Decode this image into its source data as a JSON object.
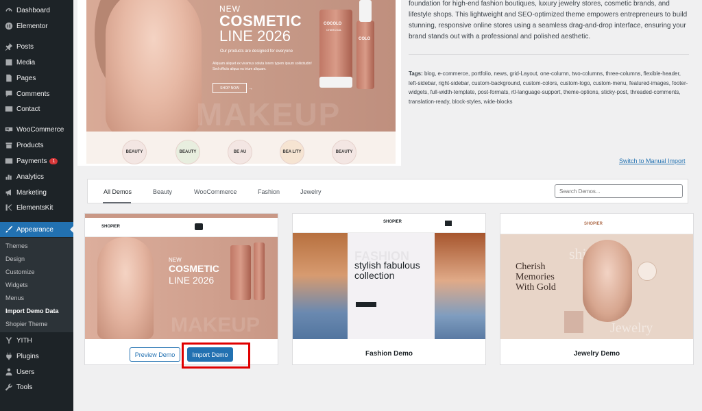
{
  "sidebar": {
    "items": [
      {
        "label": "Dashboard",
        "icon": "dashboard-icon"
      },
      {
        "label": "Elementor",
        "icon": "elementor-icon"
      },
      {
        "label": "Posts",
        "icon": "pin-icon"
      },
      {
        "label": "Media",
        "icon": "media-icon"
      },
      {
        "label": "Pages",
        "icon": "pages-icon"
      },
      {
        "label": "Comments",
        "icon": "comment-icon"
      },
      {
        "label": "Contact",
        "icon": "mail-icon"
      },
      {
        "label": "WooCommerce",
        "icon": "woocommerce-icon"
      },
      {
        "label": "Products",
        "icon": "products-icon"
      },
      {
        "label": "Payments",
        "icon": "payments-icon",
        "badge": "1"
      },
      {
        "label": "Analytics",
        "icon": "analytics-icon"
      },
      {
        "label": "Marketing",
        "icon": "megaphone-icon"
      },
      {
        "label": "ElementsKit",
        "icon": "elementskit-icon"
      },
      {
        "label": "Appearance",
        "icon": "brush-icon"
      },
      {
        "label": "YITH",
        "icon": "yith-icon"
      },
      {
        "label": "Plugins",
        "icon": "plugin-icon"
      },
      {
        "label": "Users",
        "icon": "users-icon"
      },
      {
        "label": "Tools",
        "icon": "wrench-icon"
      }
    ],
    "submenu": [
      "Themes",
      "Design",
      "Customize",
      "Widgets",
      "Menus",
      "Import Demo Data",
      "Shopier Theme"
    ]
  },
  "hero": {
    "new": "NEW",
    "title": "COSMETIC",
    "line": "LINE 2026",
    "subtitle": "Our products are designed for everyone",
    "description": "Aliquam aliquet ex vivamus soluta lorem typem ipsum sollicitudin! Sed officiis aliqua eu trium aliquam.",
    "shop": "SHOP NOW",
    "watermark": "MAKEUP",
    "product_brand": "COCOLO",
    "product_type": "CHARCOAL",
    "product_short": "COLO",
    "badges": [
      "BEAUTY",
      "BEAUTY",
      "BE AU",
      "BEA LITY",
      "BEAUTY"
    ]
  },
  "theme_description": "foundation for high-end fashion boutiques, luxury jewelry stores, cosmetic brands, and lifestyle shops. This lightweight and SEO-optimized theme empowers entrepreneurs to build stunning, responsive online stores using a seamless drag-and-drop interface, ensuring your brand stands out with a professional and polished aesthetic.",
  "tags_label": "Tags:",
  "tags": "blog, e-commerce, portfolio, news, grid-Layout, one-column, two-columns, three-columns, flexible-header, left-sidebar, right-sidebar, custom-background, custom-colors, custom-logo, custom-menu, featured-images, footer-widgets, full-width-template, post-formats, rtl-language-support, theme-options, sticky-post, threaded-comments, translation-ready, block-styles, wide-blocks",
  "manual_import": "Switch to Manual Import",
  "filters": {
    "tabs": [
      "All Demos",
      "Beauty",
      "WooCommerce",
      "Fashion",
      "Jewelry"
    ],
    "search_placeholder": "Search Demos..."
  },
  "cards": [
    {
      "title": "",
      "logo": "SHOPIER",
      "preview_label": "Preview Demo",
      "import_label": "Import Demo",
      "new": "NEW",
      "headline1": "COSMETIC",
      "headline2": "LINE 2026",
      "watermark": "MAKEUP"
    },
    {
      "title": "Fashion Demo",
      "logo": "SHOPIER",
      "headline": "stylish fabulous collection",
      "watermark": "FASHION"
    },
    {
      "title": "Jewelry Demo",
      "logo": "SHOPIER",
      "headline": "Cherish Memories With Gold",
      "watermark1": "shine",
      "watermark2": "Jewelry"
    }
  ],
  "colors": {
    "sidebar": "#1d2327",
    "accent": "#2271b1",
    "highlight": "#e00000"
  }
}
